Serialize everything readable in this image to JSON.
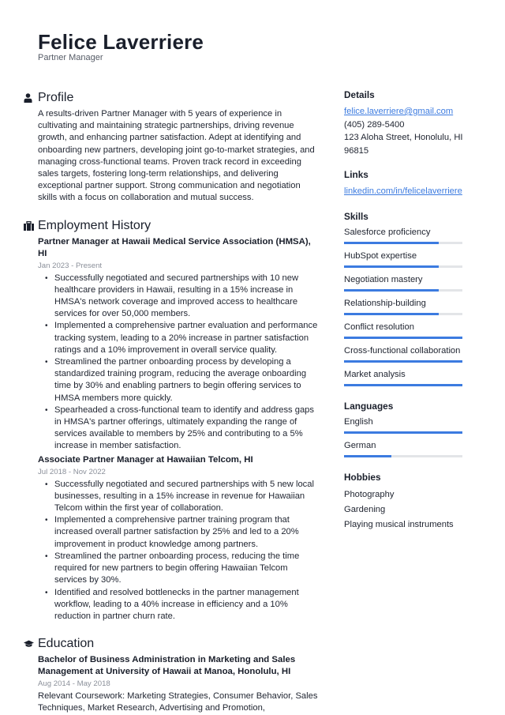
{
  "header": {
    "name": "Felice Laverriere",
    "title": "Partner Manager"
  },
  "profile": {
    "heading": "Profile",
    "icon": "person-icon",
    "text": "A results-driven Partner Manager with 5 years of experience in cultivating and maintaining strategic partnerships, driving revenue growth, and enhancing partner satisfaction. Adept at identifying and onboarding new partners, developing joint go-to-market strategies, and managing cross-functional teams. Proven track record in exceeding sales targets, fostering long-term relationships, and delivering exceptional partner support. Strong communication and negotiation skills with a focus on collaboration and mutual success."
  },
  "employment": {
    "heading": "Employment History",
    "icon": "briefcase-icon",
    "jobs": [
      {
        "title": "Partner Manager at Hawaii Medical Service Association (HMSA), HI",
        "dates": "Jan 2023 - Present",
        "bullets": [
          "Successfully negotiated and secured partnerships with 10 new healthcare providers in Hawaii, resulting in a 15% increase in HMSA's network coverage and improved access to healthcare services for over 50,000 members.",
          "Implemented a comprehensive partner evaluation and performance tracking system, leading to a 20% increase in partner satisfaction ratings and a 10% improvement in overall service quality.",
          "Streamlined the partner onboarding process by developing a standardized training program, reducing the average onboarding time by 30% and enabling partners to begin offering services to HMSA members more quickly.",
          "Spearheaded a cross-functional team to identify and address gaps in HMSA's partner offerings, ultimately expanding the range of services available to members by 25% and contributing to a 5% increase in member satisfaction."
        ]
      },
      {
        "title": "Associate Partner Manager at Hawaiian Telcom, HI",
        "dates": "Jul 2018 - Nov 2022",
        "bullets": [
          "Successfully negotiated and secured partnerships with 5 new local businesses, resulting in a 15% increase in revenue for Hawaiian Telcom within the first year of collaboration.",
          "Implemented a comprehensive partner training program that increased overall partner satisfaction by 25% and led to a 20% improvement in product knowledge among partners.",
          "Streamlined the partner onboarding process, reducing the time required for new partners to begin offering Hawaiian Telcom services by 30%.",
          "Identified and resolved bottlenecks in the partner management workflow, leading to a 40% increase in efficiency and a 10% reduction in partner churn rate."
        ]
      }
    ]
  },
  "education": {
    "heading": "Education",
    "icon": "graduation-cap-icon",
    "entries": [
      {
        "title": "Bachelor of Business Administration in Marketing and Sales Management at University of Hawaii at Manoa, Honolulu, HI",
        "dates": "Aug 2014 - May 2018",
        "text": "Relevant Coursework: Marketing Strategies, Consumer Behavior, Sales Techniques, Market Research, Advertising and Promotion,"
      }
    ]
  },
  "details": {
    "heading": "Details",
    "email": "felice.laverriere@gmail.com",
    "phone": "(405) 289-5400",
    "address": "123 Aloha Street, Honolulu, HI 96815"
  },
  "links": {
    "heading": "Links",
    "items": [
      "linkedin.com/in/felicelaverriere"
    ]
  },
  "skills": {
    "heading": "Skills",
    "items": [
      {
        "label": "Salesforce proficiency",
        "level": 0.8
      },
      {
        "label": "HubSpot expertise",
        "level": 0.8
      },
      {
        "label": "Negotiation mastery",
        "level": 0.8
      },
      {
        "label": "Relationship-building",
        "level": 0.8
      },
      {
        "label": "Conflict resolution",
        "level": 1.0
      },
      {
        "label": "Cross-functional collaboration",
        "level": 1.0
      },
      {
        "label": "Market analysis",
        "level": 1.0
      }
    ]
  },
  "languages": {
    "heading": "Languages",
    "items": [
      {
        "label": "English",
        "level": 1.0
      },
      {
        "label": "German",
        "level": 0.4
      }
    ]
  },
  "hobbies": {
    "heading": "Hobbies",
    "items": [
      "Photography",
      "Gardening",
      "Playing musical instruments"
    ]
  },
  "colors": {
    "accent": "#3c7be0",
    "track": "#e3e5e8",
    "text": "#1f2430",
    "muted": "#8b909a"
  }
}
